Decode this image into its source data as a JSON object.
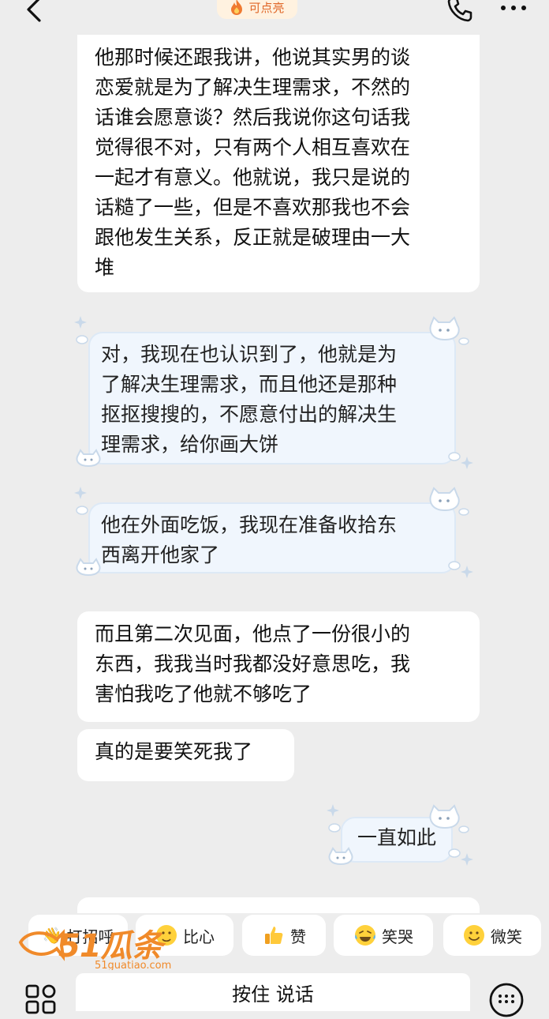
{
  "header": {
    "hot_label": "可点亮"
  },
  "messages": [
    {
      "id": "m1",
      "lines": [
        "他那时候还跟我讲，他说其实男的谈",
        "恋爱就是为了解决生理需求，不然的",
        "话谁会愿意谈？然后我说你这句话我",
        "觉得很不对，只有两个人相互喜欢在",
        "一起才有意义。他就说，我只是说的",
        "话糙了一些，但是不喜欢那我也不会",
        "跟他发生关系，反正就是破理由一大",
        "堆"
      ]
    },
    {
      "id": "m2",
      "lines": [
        "对，我现在也认识到了，他就是为",
        "了解决生理需求，而且他还是那种",
        "抠抠搜搜的，不愿意付出的解决生",
        "理需求，给你画大饼"
      ]
    },
    {
      "id": "m3",
      "lines": [
        "他在外面吃饭，我现在准备收拾东",
        "西离开他家了"
      ]
    },
    {
      "id": "m4",
      "lines": [
        "而且第二次见面，他点了一份很小的",
        "东西，我我当时我都没好意思吃，我",
        "害怕我吃了他就不够吃了"
      ]
    },
    {
      "id": "m5",
      "lines": [
        "真的是要笑死我了"
      ]
    },
    {
      "id": "m6",
      "lines": [
        "一直如此"
      ]
    }
  ],
  "quick_replies": [
    {
      "label": "打招呼",
      "icon": "wave-icon"
    },
    {
      "label": "比心",
      "icon": "heart-hands-emoji-icon"
    },
    {
      "label": "赞",
      "icon": "thumbs-up-emoji-icon"
    },
    {
      "label": "笑哭",
      "icon": "laugh-cry-emoji-icon"
    },
    {
      "label": "微笑",
      "icon": "smile-emoji-icon"
    }
  ],
  "input": {
    "voice_label": "按住 说话"
  },
  "watermark": {
    "text": "51瓜条",
    "url_text": "51guatiao.com"
  },
  "colors": {
    "background": "#ededed",
    "bubble": "#ffffff",
    "cute_bubble": "#f0f6fd",
    "hot_accent": "#e0682a",
    "watermark": "#f08a2a"
  }
}
